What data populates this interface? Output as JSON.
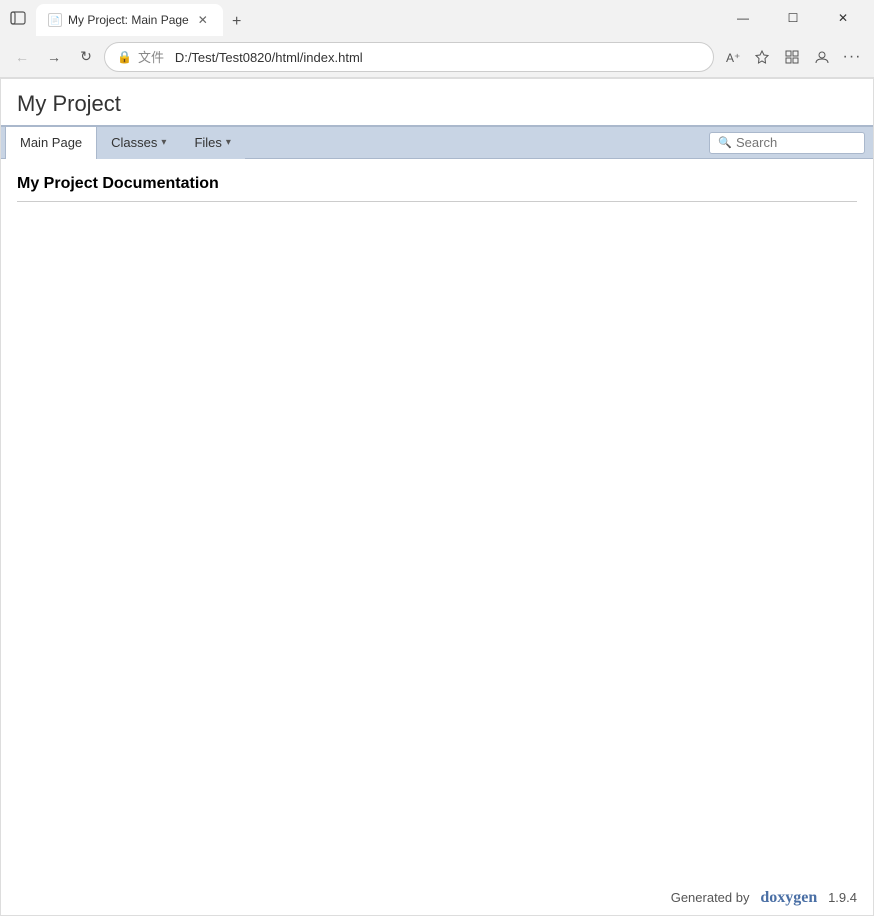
{
  "browser": {
    "tab_title": "My Project: Main Page",
    "tab_favicon": "📄",
    "address_bar": {
      "icon": "文件",
      "url": "D:/Test/Test0820/html/index.html"
    },
    "window_controls": {
      "minimize": "—",
      "maximize": "☐",
      "close": "✕"
    },
    "new_tab": "+"
  },
  "nav": {
    "main_page_label": "Main Page",
    "classes_label": "Classes",
    "files_label": "Files",
    "search_placeholder": "Search"
  },
  "page": {
    "project_title": "My Project",
    "heading": "My Project Documentation",
    "footer_generated": "Generated by",
    "footer_doxygen": "doxygen",
    "footer_version": "1.9.4"
  }
}
